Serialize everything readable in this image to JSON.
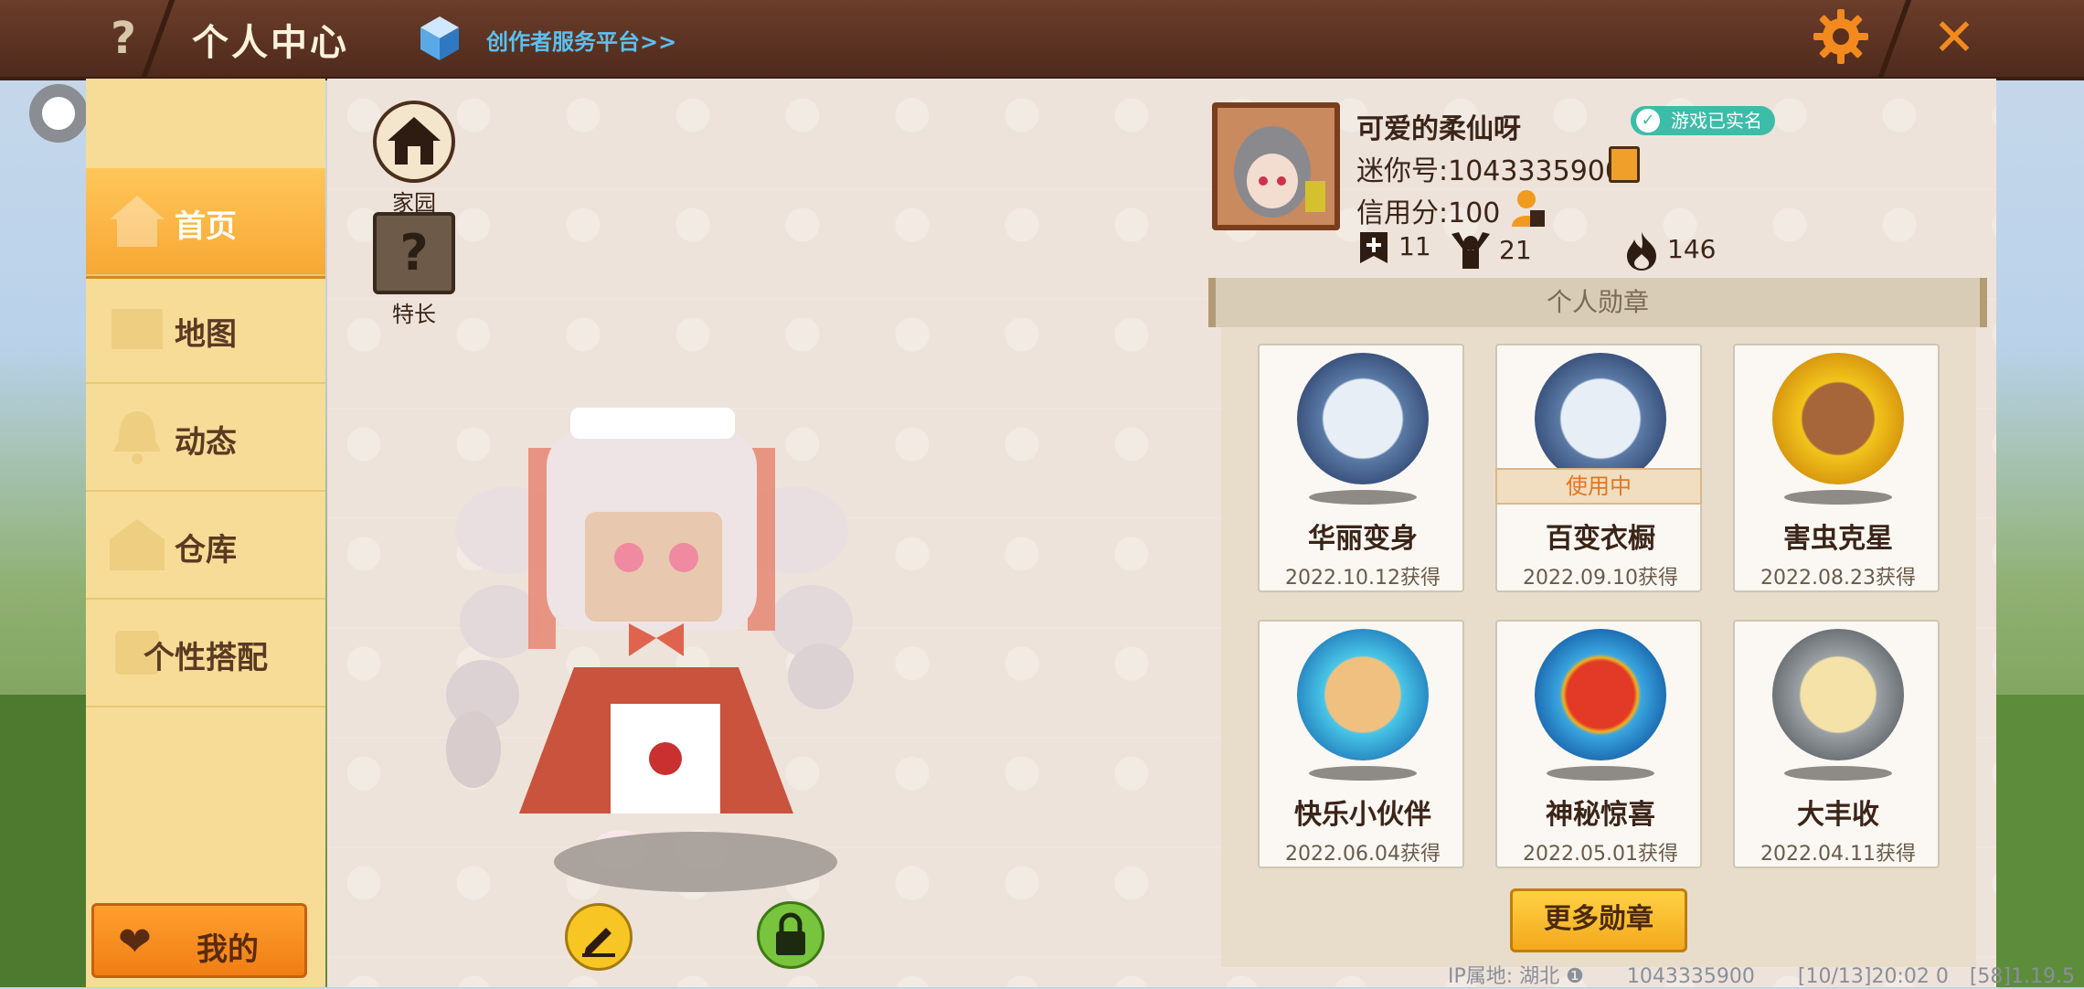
{
  "header": {
    "help_label": "?",
    "title": "个人中心",
    "creator_link": "创作者服务平台>>",
    "close_label": "✕"
  },
  "sidebar": {
    "items": [
      {
        "label": "首页",
        "active": true
      },
      {
        "label": "地图",
        "active": false
      },
      {
        "label": "动态",
        "active": false
      },
      {
        "label": "仓库",
        "active": false
      },
      {
        "label": "个性搭配",
        "active": false
      }
    ],
    "my_button": "我的"
  },
  "shortcuts": {
    "home": "家园",
    "special": "特长",
    "special_icon": "?"
  },
  "profile": {
    "nickname": "可爱的柔仙呀",
    "verified": "游戏已实名",
    "mini_id": "迷你号:1043335900",
    "credit": "信用分:100",
    "stats": {
      "add": "11",
      "fans": "21",
      "heat": "146"
    }
  },
  "medals": {
    "header": "个人勋章",
    "in_use_label": "使用中",
    "items": [
      {
        "name": "华丽变身",
        "date": "2022.10.12获得",
        "color": "#5b7aa6"
      },
      {
        "name": "百变衣橱",
        "date": "2022.09.10获得",
        "color": "#5b7aa6"
      },
      {
        "name": "害虫克星",
        "date": "2022.08.23获得",
        "color": "#f2c51c"
      },
      {
        "name": "快乐小伙伴",
        "date": "2022.06.04获得",
        "color": "#48c6e8"
      },
      {
        "name": "神秘惊喜",
        "date": "2022.05.01获得",
        "color": "#3aa6e0"
      },
      {
        "name": "大丰收",
        "date": "2022.04.11获得",
        "color": "#9aa0a4"
      }
    ],
    "more_button": "更多勋章"
  },
  "footer": {
    "ip": "IP属地: 湖北 ❶",
    "id": "1043335900",
    "build": "[10/13]20:02 0",
    "version": "[58]1.19.5"
  }
}
